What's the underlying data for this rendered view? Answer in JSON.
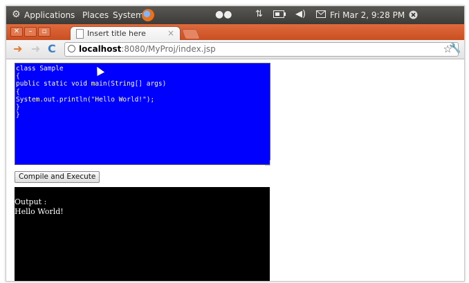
{
  "panel": {
    "applications": "Applications",
    "places": "Places",
    "system": "System",
    "clock": "Fri Mar 2,  9:28 PM"
  },
  "tab": {
    "title": "Insert title here"
  },
  "address_bar": {
    "host": "localhost",
    "path": ":8080/MyProj/index.jsp"
  },
  "editor": {
    "code": "class Sample\n{\npublic static void main(String[] args)\n{\nSystem.out.println(\"Hello World!\");\n}\n}"
  },
  "run_button": {
    "label": "Compile and Execute"
  },
  "output": {
    "label": "Output :",
    "result": "Hello World!"
  },
  "colors": {
    "panel": "#3c3b37",
    "tabstrip": "#d4572a",
    "editor_bg": "#0000ff",
    "output_bg": "#000000"
  },
  "icons": [
    "gear-icon",
    "firefox-icon",
    "indicator-icon",
    "network-icon",
    "battery-icon",
    "volume-icon",
    "mail-icon",
    "power-icon",
    "page-icon",
    "close-icon",
    "back-icon",
    "forward-icon",
    "reload-icon",
    "globe-icon",
    "star-icon",
    "wrench-icon",
    "mouse-cursor-icon"
  ]
}
